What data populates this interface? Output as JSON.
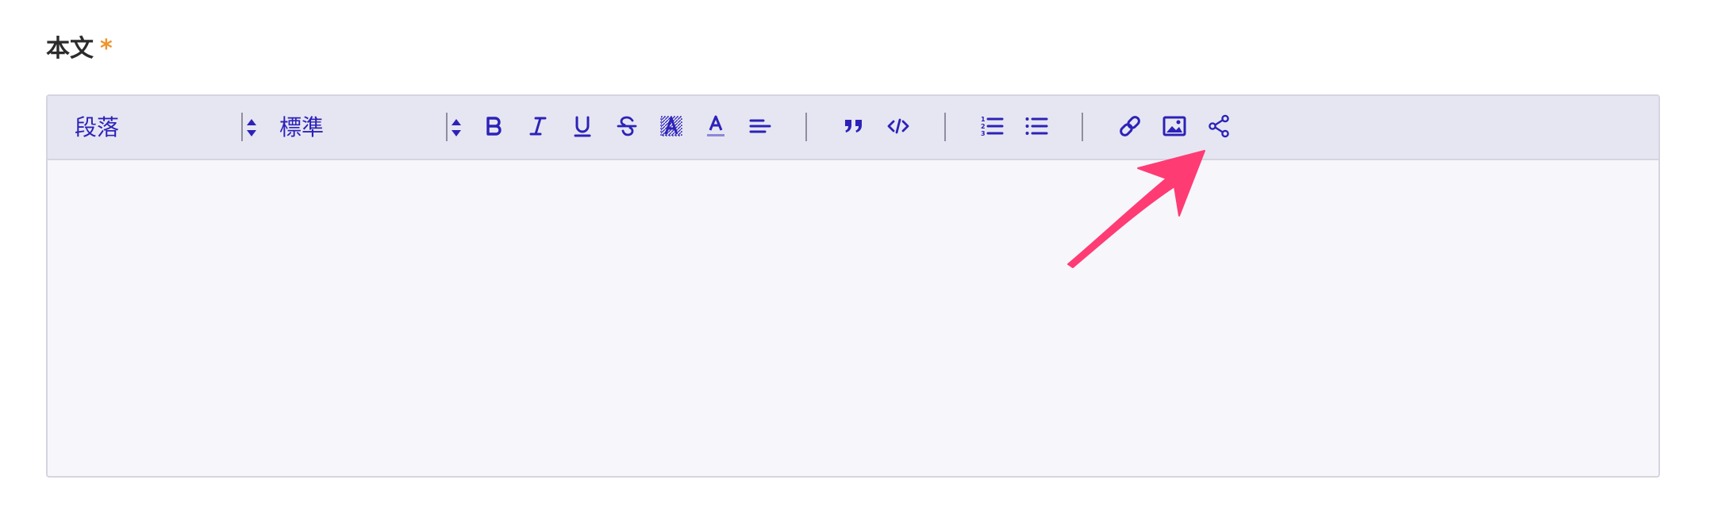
{
  "field": {
    "label": "本文",
    "required_mark": "*"
  },
  "toolbar": {
    "paragraph_select": "段落",
    "size_select": "標準",
    "buttons": [
      {
        "name": "bold-button",
        "icon": "bold-icon"
      },
      {
        "name": "italic-button",
        "icon": "italic-icon"
      },
      {
        "name": "underline-button",
        "icon": "underline-icon"
      },
      {
        "name": "strikethrough-button",
        "icon": "strikethrough-icon"
      },
      {
        "name": "highlight-button",
        "icon": "highlight-icon"
      },
      {
        "name": "text-color-button",
        "icon": "text-color-icon"
      },
      {
        "name": "align-button",
        "icon": "align-left-icon"
      },
      {
        "name": "blockquote-button",
        "icon": "quote-icon"
      },
      {
        "name": "code-button",
        "icon": "code-icon"
      },
      {
        "name": "ordered-list-button",
        "icon": "ordered-list-icon"
      },
      {
        "name": "bullet-list-button",
        "icon": "bullet-list-icon"
      },
      {
        "name": "link-button",
        "icon": "link-icon"
      },
      {
        "name": "image-button",
        "icon": "image-icon"
      },
      {
        "name": "share-embed-button",
        "icon": "share-icon"
      }
    ]
  },
  "colors": {
    "accent": "#2d22b8",
    "toolbar_bg": "#e6e6f2",
    "editor_bg": "#f6f6fb",
    "required": "#f0932b",
    "annotation_arrow": "#ff3b74"
  },
  "editor": {
    "content": ""
  }
}
